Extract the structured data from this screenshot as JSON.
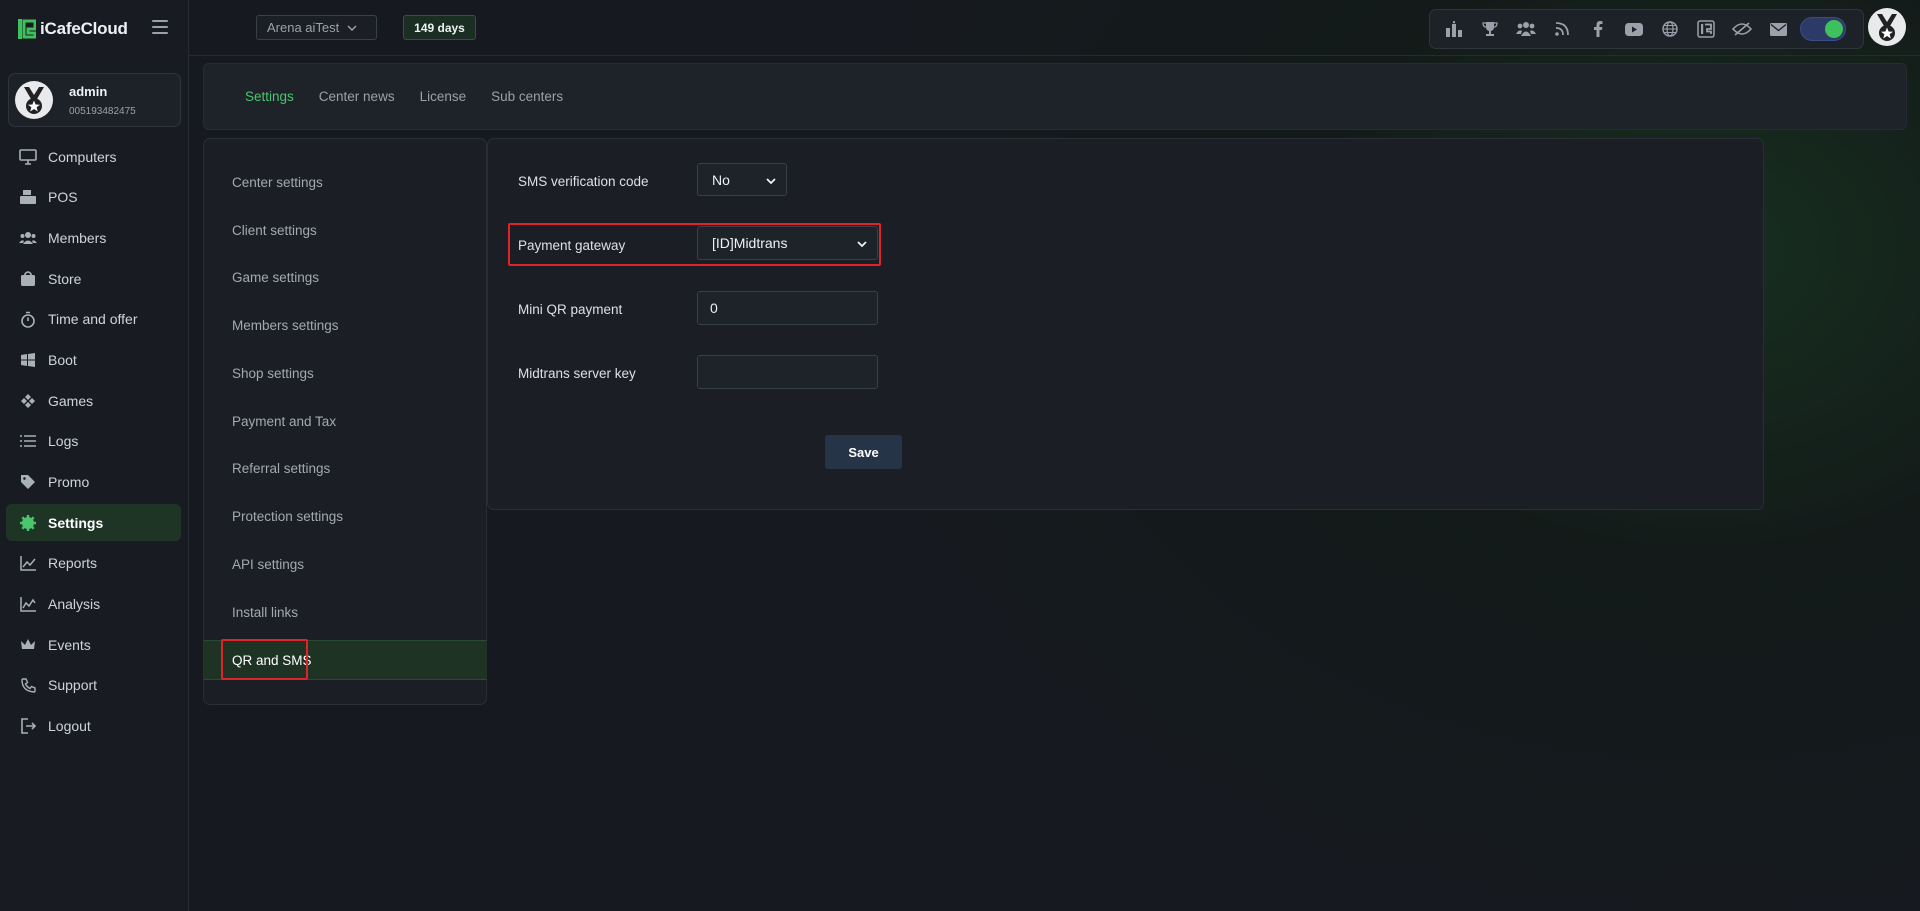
{
  "app": {
    "logo_text": "iCafeCloud"
  },
  "user": {
    "name": "admin",
    "id": "005193482475"
  },
  "nav": [
    {
      "key": "computers",
      "label": "Computers",
      "icon": "monitor-icon"
    },
    {
      "key": "pos",
      "label": "POS",
      "icon": "pos-register-icon"
    },
    {
      "key": "members",
      "label": "Members",
      "icon": "users-icon"
    },
    {
      "key": "store",
      "label": "Store",
      "icon": "shopping-bag-icon"
    },
    {
      "key": "time",
      "label": "Time and offer",
      "icon": "stopwatch-icon"
    },
    {
      "key": "boot",
      "label": "Boot",
      "icon": "windows-icon"
    },
    {
      "key": "games",
      "label": "Games",
      "icon": "gamepad-icon"
    },
    {
      "key": "logs",
      "label": "Logs",
      "icon": "list-icon"
    },
    {
      "key": "promo",
      "label": "Promo",
      "icon": "tag-icon"
    },
    {
      "key": "settings",
      "label": "Settings",
      "icon": "gear-icon",
      "active": true
    },
    {
      "key": "reports",
      "label": "Reports",
      "icon": "line-chart-icon"
    },
    {
      "key": "analysis",
      "label": "Analysis",
      "icon": "area-chart-icon"
    },
    {
      "key": "events",
      "label": "Events",
      "icon": "crown-icon"
    },
    {
      "key": "support",
      "label": "Support",
      "icon": "phone-icon"
    },
    {
      "key": "logout",
      "label": "Logout",
      "icon": "logout-icon"
    }
  ],
  "topbar": {
    "center_name": "Arena aiTest",
    "days_label": "149 days",
    "icons": [
      "ranking-icon",
      "trophy-icon",
      "group-icon",
      "rss-icon",
      "facebook-icon",
      "youtube-icon",
      "globe-icon",
      "icafe-icon",
      "eye-slash-icon",
      "mail-icon"
    ],
    "toggle_on": true
  },
  "tabs": [
    {
      "label": "Settings",
      "active": true
    },
    {
      "label": "Center news"
    },
    {
      "label": "License"
    },
    {
      "label": "Sub centers"
    }
  ],
  "submenu": [
    {
      "label": "Center settings"
    },
    {
      "label": "Client settings"
    },
    {
      "label": "Game settings"
    },
    {
      "label": "Members settings"
    },
    {
      "label": "Shop settings"
    },
    {
      "label": "Payment and Tax"
    },
    {
      "label": "Referral settings"
    },
    {
      "label": "Protection settings"
    },
    {
      "label": "API settings"
    },
    {
      "label": "Install links"
    },
    {
      "label": "QR and SMS",
      "active": true
    }
  ],
  "form": {
    "sms_label": "SMS verification code",
    "sms_value": "No",
    "gateway_label": "Payment gateway",
    "gateway_value": "[ID]Midtrans",
    "mini_qr_label": "Mini QR payment",
    "mini_qr_value": "0",
    "server_key_label": "Midtrans server key",
    "server_key_value": "",
    "save_label": "Save"
  },
  "colors": {
    "accent": "#4cc66d",
    "highlight": "#e0222a",
    "background": "#171b21"
  }
}
